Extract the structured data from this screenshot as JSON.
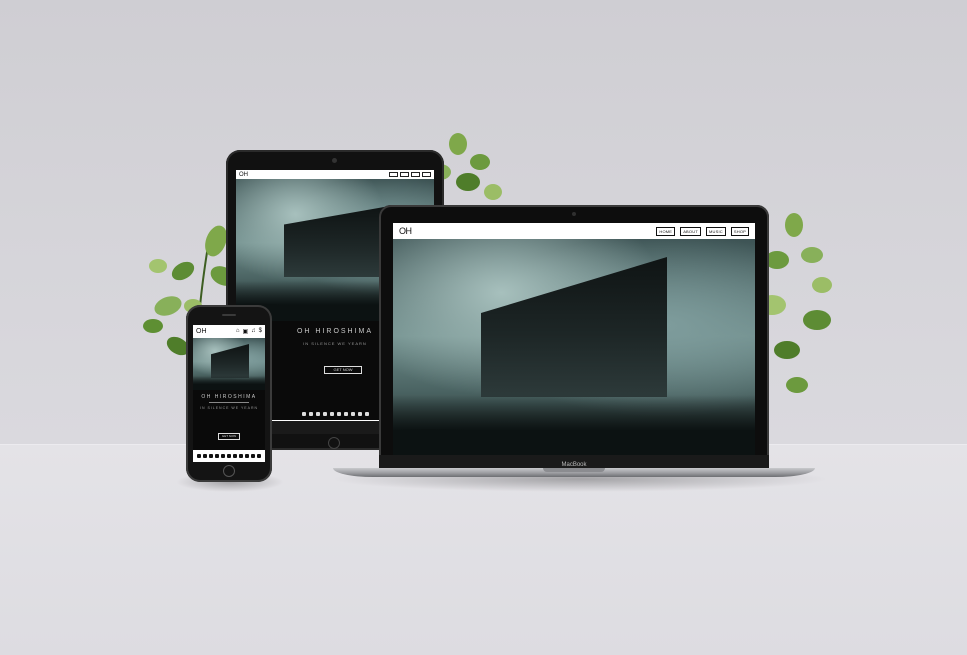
{
  "scene": {
    "wall_color": "#d0cfd4",
    "floor_color": "#e2e1e5"
  },
  "laptop": {
    "brand": "MacBook",
    "site": {
      "logo": "OH",
      "nav": [
        "HOME",
        "ABOUT",
        "MUSIC",
        "SHOP"
      ]
    }
  },
  "tablet": {
    "site": {
      "logo": "OH",
      "title": "OH HIROSHIMA",
      "subtitle": "IN SILENCE WE YEARN",
      "button": "GET NOW"
    }
  },
  "phone": {
    "site": {
      "logo": "OH",
      "nav_icons": [
        "home-icon",
        "gallery-icon",
        "music-icon",
        "dollar-icon"
      ],
      "nav_glyphs": [
        "⌂",
        "▣",
        "♫",
        "$"
      ],
      "title": "OH HIROSHIMA",
      "subtitle": "IN SILENCE WE YEARN",
      "button": "GET NOW"
    }
  }
}
